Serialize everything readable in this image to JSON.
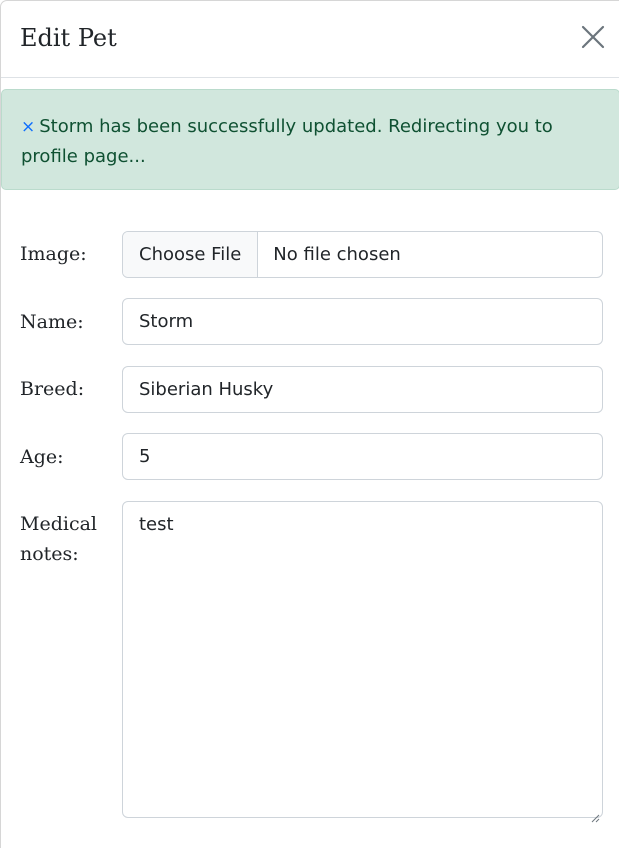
{
  "modal": {
    "title": "Edit Pet",
    "close_icon": "close-icon"
  },
  "alert": {
    "dismiss_glyph": "×",
    "message": "Storm has been successfully updated. Redirecting you to profile page...",
    "colors": {
      "background": "#d1e7dd",
      "border": "#badbcc",
      "text": "#0f5132",
      "dismiss": "#0d6efd"
    }
  },
  "form": {
    "image": {
      "label": "Image:",
      "button_label": "Choose File",
      "status": "No file chosen"
    },
    "name": {
      "label": "Name:",
      "value": "Storm"
    },
    "breed": {
      "label": "Breed:",
      "value": "Siberian Husky"
    },
    "age": {
      "label": "Age:",
      "value": "5"
    },
    "medical_notes": {
      "label": "Medical notes:",
      "value": "test"
    }
  }
}
